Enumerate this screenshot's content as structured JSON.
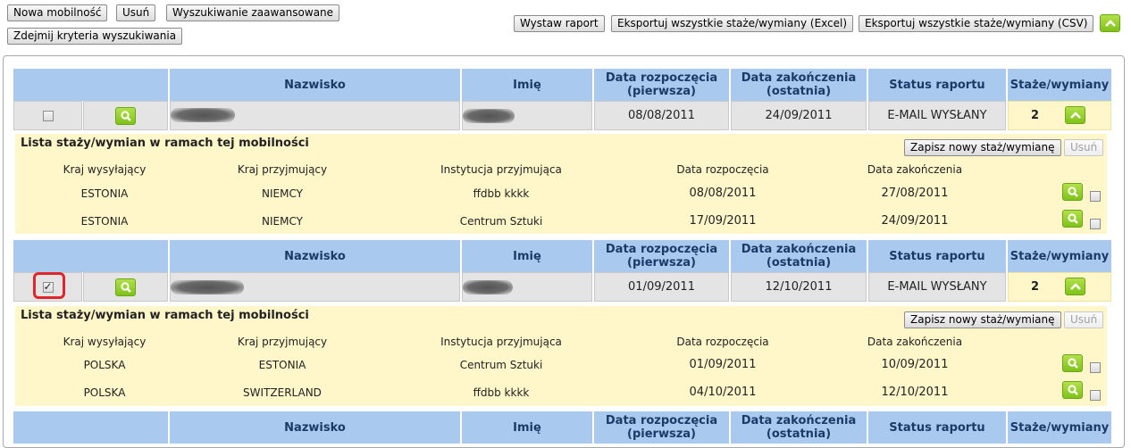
{
  "toolbar": {
    "new_label": "Nowa mobilność",
    "delete_label": "Usuń",
    "advanced_search_label": "Wyszukiwanie zaawansowane",
    "clear_criteria_label": "Zdejmij kryteria wyszukiwania",
    "report_label": "Wystaw raport",
    "export_excel_label": "Eksportuj wszystkie staże/wymiany (Excel)",
    "export_csv_label": "Eksportuj wszystkie staże/wymiany (CSV)"
  },
  "columns": {
    "nazwisko": "Nazwisko",
    "imie": "Imię",
    "start_line1": "Data rozpoczęcia",
    "start_line2": "(pierwsza)",
    "end_line1": "Data zakończenia",
    "end_line2": "(ostatnia)",
    "status": "Status raportu",
    "count": "Staże/wymiany"
  },
  "sub_columns": {
    "sending": "Kraj wysyłający",
    "receiving": "Kraj przyjmujący",
    "institution": "Instytucja przyjmująca",
    "start": "Data rozpoczęcia",
    "end": "Data zakończenia"
  },
  "sub_title": "Lista staży/wymian w ramach tej mobilności",
  "sub_add_label": "Zapisz nowy staż/wymianę",
  "sub_delete_label": "Usuń",
  "colors": {
    "header_blue": "#a9c9ef",
    "yellow": "#fff6c9",
    "green": "#8fd126",
    "highlight": "#e0262b"
  },
  "mobilities": [
    {
      "checked": false,
      "start": "08/08/2011",
      "end": "24/09/2011",
      "status": "E-MAIL WYSŁANY",
      "count": "2",
      "internships": [
        {
          "sending": "ESTONIA",
          "receiving": "NIEMCY",
          "institution": "ffdbb kkkk",
          "start": "08/08/2011",
          "end": "27/08/2011"
        },
        {
          "sending": "ESTONIA",
          "receiving": "NIEMCY",
          "institution": "Centrum Sztuki",
          "start": "17/09/2011",
          "end": "24/09/2011"
        }
      ]
    },
    {
      "checked": true,
      "start": "01/09/2011",
      "end": "12/10/2011",
      "status": "E-MAIL WYSŁANY",
      "count": "2",
      "internships": [
        {
          "sending": "POLSKA",
          "receiving": "ESTONIA",
          "institution": "Centrum Sztuki",
          "start": "01/09/2011",
          "end": "10/09/2011"
        },
        {
          "sending": "POLSKA",
          "receiving": "SWITZERLAND",
          "institution": "ffdbb kkkk",
          "start": "04/10/2011",
          "end": "12/10/2011"
        }
      ]
    }
  ]
}
